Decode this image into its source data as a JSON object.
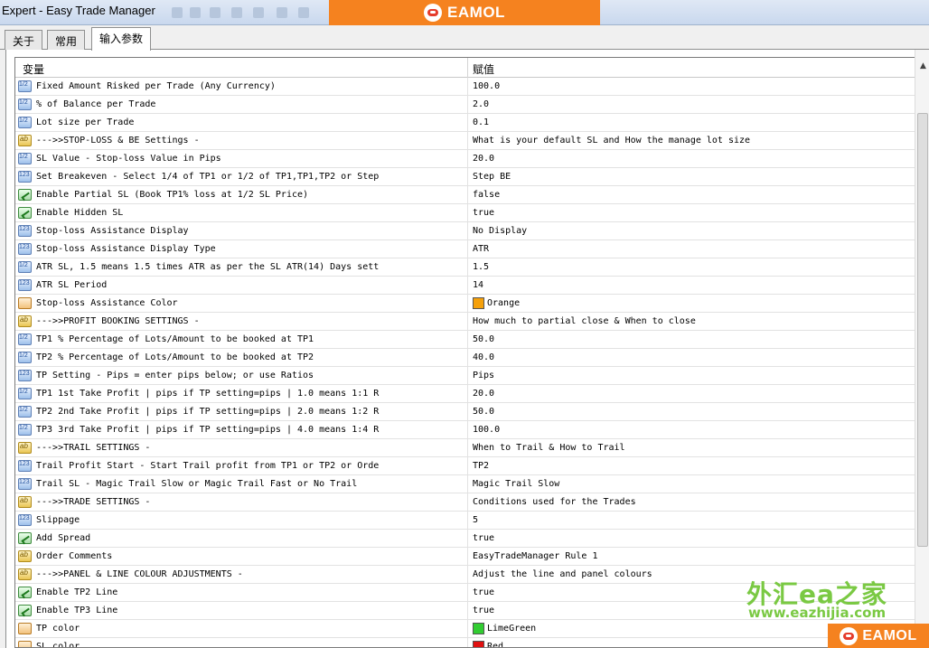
{
  "window": {
    "title": "Expert - Easy Trade Manager"
  },
  "brand": {
    "banner_text": "EAMOL",
    "watermark_cn": "外汇ea之家",
    "watermark_url": "www.eazhijia.com",
    "watermark_brand": "EAMOL",
    "color": "#f5821f",
    "watermark_color": "#7ac943"
  },
  "tabs": [
    {
      "label": "关于",
      "active": false
    },
    {
      "label": "常用",
      "active": false
    },
    {
      "label": "输入参数",
      "active": true
    }
  ],
  "grid": {
    "headers": {
      "variable": "变量",
      "value": "赋值"
    },
    "rows": [
      {
        "icon": "num-icon",
        "name": "Fixed Amount Risked per Trade (Any Currency)",
        "value": "100.0"
      },
      {
        "icon": "num-icon",
        "name": "% of Balance per Trade",
        "value": "2.0"
      },
      {
        "icon": "num-icon",
        "name": "Lot size per Trade",
        "value": "0.1"
      },
      {
        "icon": "string-icon",
        "name": "--->>STOP-LOSS & BE Settings -",
        "value": "What is your default SL and How the manage lot size"
      },
      {
        "icon": "num-icon",
        "name": "SL Value - Stop-loss Value in Pips",
        "value": "20.0"
      },
      {
        "icon": "enum-icon",
        "name": "Set Breakeven - Select 1/4 of TP1 or 1/2 of TP1,TP1,TP2 or Step",
        "value": "Step BE"
      },
      {
        "icon": "bool-icon",
        "name": "Enable Partial SL (Book TP1% loss at 1/2 SL Price)",
        "value": "false"
      },
      {
        "icon": "bool-icon",
        "name": "Enable Hidden SL",
        "value": "true"
      },
      {
        "icon": "enum-icon",
        "name": "Stop-loss Assistance Display",
        "value": "No Display"
      },
      {
        "icon": "enum-icon",
        "name": "Stop-loss Assistance Display Type",
        "value": "ATR"
      },
      {
        "icon": "num-icon",
        "name": "ATR SL, 1.5 means 1.5 times ATR as per the SL ATR(14) Days sett",
        "value": "1.5"
      },
      {
        "icon": "enum-icon",
        "name": "ATR SL Period",
        "value": "14"
      },
      {
        "icon": "color-icon",
        "name": "Stop-loss Assistance Color",
        "value": "Orange",
        "swatch": "#f5a00a"
      },
      {
        "icon": "string-icon",
        "name": "--->>PROFIT BOOKING SETTINGS -",
        "value": "How much to partial close & When to close"
      },
      {
        "icon": "num-icon",
        "name": "TP1 % Percentage of Lots/Amount to be booked at TP1",
        "value": "50.0"
      },
      {
        "icon": "num-icon",
        "name": "TP2 % Percentage of Lots/Amount to be booked at TP2",
        "value": "40.0"
      },
      {
        "icon": "enum-icon",
        "name": "TP Setting - Pips = enter pips below; or use Ratios",
        "value": "Pips"
      },
      {
        "icon": "num-icon",
        "name": "TP1 1st Take Profit | pips if TP setting=pips | 1.0 means 1:1 R",
        "value": "20.0"
      },
      {
        "icon": "num-icon",
        "name": "TP2 2nd Take Profit | pips if TP setting=pips | 2.0 means 1:2 R",
        "value": "50.0"
      },
      {
        "icon": "num-icon",
        "name": "TP3 3rd Take Profit | pips if TP setting=pips | 4.0 means 1:4 R",
        "value": "100.0"
      },
      {
        "icon": "string-icon",
        "name": "--->>TRAIL SETTINGS -",
        "value": "When to Trail & How to Trail"
      },
      {
        "icon": "enum-icon",
        "name": "Trail Profit Start - Start Trail profit from TP1 or TP2 or Orde",
        "value": "TP2"
      },
      {
        "icon": "enum-icon",
        "name": "Trail SL - Magic Trail Slow or Magic Trail Fast or No Trail",
        "value": "Magic Trail Slow"
      },
      {
        "icon": "string-icon",
        "name": "--->>TRADE SETTINGS -",
        "value": "Conditions used for the Trades"
      },
      {
        "icon": "enum-icon",
        "name": "Slippage",
        "value": "5"
      },
      {
        "icon": "bool-icon",
        "name": "Add Spread",
        "value": "true"
      },
      {
        "icon": "string-icon",
        "name": "Order Comments",
        "value": "EasyTradeManager Rule 1"
      },
      {
        "icon": "string-icon",
        "name": "--->>PANEL & LINE COLOUR ADJUSTMENTS -",
        "value": "Adjust the line and panel colours"
      },
      {
        "icon": "bool-icon",
        "name": "Enable TP2 Line",
        "value": "true"
      },
      {
        "icon": "bool-icon",
        "name": "Enable TP3 Line",
        "value": "true"
      },
      {
        "icon": "color-icon",
        "name": "TP color",
        "value": "LimeGreen",
        "swatch": "#32cd32"
      },
      {
        "icon": "color-icon",
        "name": "SL color",
        "value": "Red",
        "swatch": "#e01010"
      }
    ]
  }
}
